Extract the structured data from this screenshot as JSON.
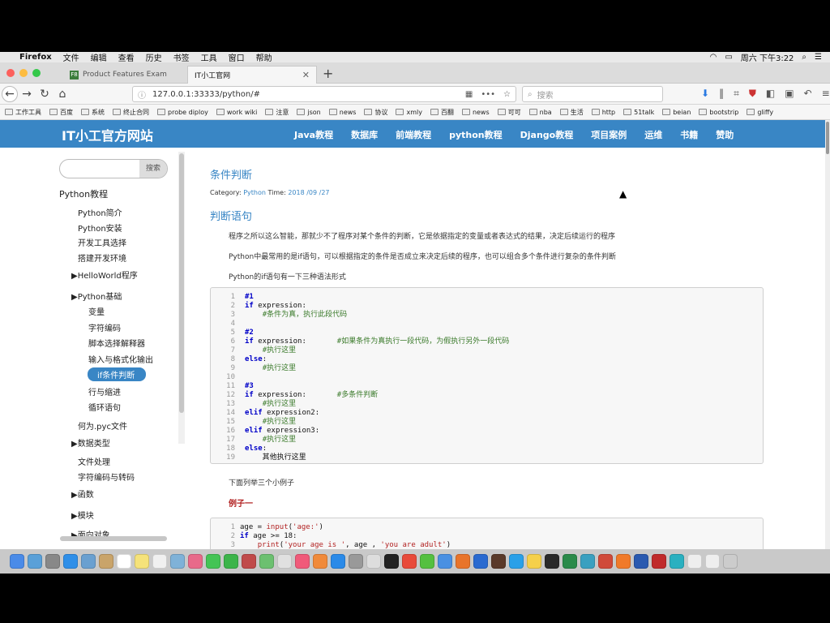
{
  "os_menubar": {
    "apple": "",
    "app": "Firefox",
    "items": [
      "文件",
      "编辑",
      "查看",
      "历史",
      "书签",
      "工具",
      "窗口",
      "帮助"
    ],
    "clock": "周六 下午3:22"
  },
  "tabs": [
    {
      "label": "Product Features Exam",
      "favicon": "F8"
    },
    {
      "label": "IT小工官网"
    }
  ],
  "url": "127.0.0.1:33333/python/#",
  "search_placeholder": "搜索",
  "bookmarks": [
    "工作工具",
    "百度",
    "系统",
    "终止合同",
    "probe diploy",
    "work wiki",
    "注意",
    "json",
    "news",
    "协议",
    "xmly",
    "百翻",
    "news",
    "可可",
    "nba",
    "生活",
    "http",
    "51talk",
    "beian",
    "bootstrip",
    "gliffy"
  ],
  "site": {
    "title": "IT小工官方网站",
    "menu": [
      "Java教程",
      "数据库",
      "前端教程",
      "python教程",
      "Django教程",
      "项目案例",
      "运维",
      "书籍",
      "赞助"
    ]
  },
  "sidebar": {
    "search_button": "搜索",
    "root": "Python教程",
    "items": {
      "intro": "Python简介",
      "install": "Python安装",
      "tools": "开发工具选择",
      "env": "搭建开发环境",
      "helloworld": "▶HelloWorld程序",
      "basics": "▶Python基础",
      "var": "变量",
      "encoding": "字符编码",
      "interp": "脚本选择解释器",
      "io": "输入与格式化输出",
      "if": "if条件判断",
      "indent": "行与缩进",
      "loop": "循环语句",
      "pyc": "何为.pyc文件",
      "datatypes": "▶数据类型",
      "file": "文件处理",
      "charconv": "字符编码与转码",
      "func": "▶函数",
      "module": "▶模块",
      "oop": "▶面向对象"
    }
  },
  "article": {
    "title": "条件判断",
    "category_label": "Category:",
    "category": "Python",
    "time_label": "Time:",
    "time": "2018 /09 /27",
    "section": "判断语句",
    "p1": "程序之所以这么智能，那就少不了程序对某个条件的判断，它是依据指定的变量或者表达式的结果，决定后续运行的程序",
    "p2": "Python中最常用的是if语句，可以根据指定的条件是否成立来决定后续的程序，也可以组合多个条件进行复杂的条件判断",
    "p3": "Python的if语句有一下三种语法形式",
    "after_code": "下面列举三个小例子",
    "example1": "例子一"
  },
  "colors": {
    "accent": "#3986c5",
    "example_red": "#b22222"
  }
}
